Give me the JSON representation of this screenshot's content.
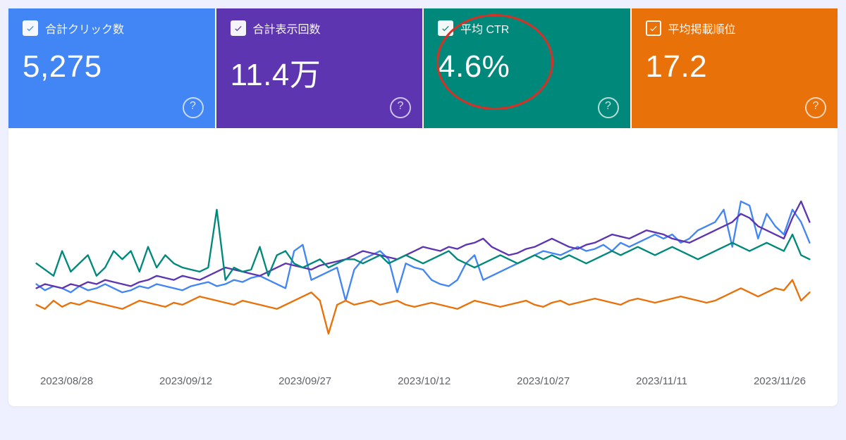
{
  "tiles": [
    {
      "key": "clicks",
      "label": "合計クリック数",
      "value": "5,275",
      "color": "#4285F4"
    },
    {
      "key": "impressions",
      "label": "合計表示回数",
      "value": "11.4万",
      "color": "#5E35B1"
    },
    {
      "key": "ctr",
      "label": "平均 CTR",
      "value": "4.6%",
      "color": "#00897B",
      "highlighted": true
    },
    {
      "key": "position",
      "label": "平均掲載順位",
      "value": "17.2",
      "color": "#E8710A"
    }
  ],
  "x_ticks": [
    "2023/08/28",
    "2023/09/12",
    "2023/09/27",
    "2023/10/12",
    "2023/10/27",
    "2023/11/11",
    "2023/11/26"
  ],
  "chart_data": {
    "type": "line",
    "title": "",
    "xlabel": "",
    "ylabel": "",
    "x_tick_labels": [
      "2023/08/28",
      "2023/09/12",
      "2023/09/27",
      "2023/10/12",
      "2023/10/27",
      "2023/11/11",
      "2023/11/26"
    ],
    "y_domain_note": "Each series is on its own scale (Google Search Console overlay). Values below are visual positions on a shared 0–100 axis where 100 is chart top and 0 is chart bottom (approximate readings from gridless figure).",
    "series": [
      {
        "name": "合計クリック数",
        "key": "clicks",
        "color": "#4285F4",
        "values": [
          38,
          35,
          37,
          36,
          34,
          37,
          35,
          36,
          38,
          36,
          34,
          35,
          37,
          36,
          38,
          37,
          36,
          35,
          37,
          38,
          39,
          37,
          38,
          40,
          39,
          41,
          42,
          40,
          38,
          36,
          54,
          57,
          40,
          42,
          44,
          46,
          30,
          45,
          50,
          52,
          54,
          50,
          34,
          48,
          46,
          45,
          40,
          38,
          37,
          40,
          48,
          52,
          40,
          42,
          44,
          46,
          48,
          50,
          52,
          54,
          53,
          52,
          54,
          56,
          54,
          55,
          57,
          54,
          58,
          56,
          58,
          60,
          62,
          60,
          62,
          58,
          60,
          64,
          66,
          68,
          74,
          56,
          78,
          76,
          60,
          72,
          66,
          62,
          74,
          68,
          58
        ]
      },
      {
        "name": "合計表示回数",
        "key": "impressions",
        "color": "#5E35B1",
        "values": [
          36,
          38,
          37,
          36,
          38,
          37,
          39,
          38,
          40,
          39,
          38,
          37,
          39,
          40,
          42,
          41,
          40,
          42,
          41,
          40,
          42,
          44,
          46,
          45,
          44,
          43,
          42,
          44,
          46,
          48,
          47,
          46,
          45,
          47,
          48,
          49,
          50,
          52,
          54,
          53,
          52,
          51,
          50,
          52,
          54,
          56,
          55,
          54,
          56,
          55,
          57,
          58,
          60,
          56,
          54,
          52,
          53,
          55,
          56,
          58,
          60,
          58,
          56,
          55,
          57,
          58,
          60,
          62,
          61,
          60,
          62,
          64,
          63,
          62,
          60,
          59,
          58,
          60,
          62,
          64,
          66,
          68,
          72,
          70,
          66,
          64,
          62,
          60,
          70,
          78,
          68
        ]
      },
      {
        "name": "平均 CTR",
        "key": "ctr",
        "color": "#00897B",
        "values": [
          48,
          45,
          42,
          54,
          44,
          48,
          52,
          42,
          46,
          54,
          50,
          54,
          44,
          56,
          46,
          52,
          48,
          46,
          45,
          44,
          46,
          74,
          40,
          46,
          44,
          45,
          56,
          42,
          52,
          54,
          48,
          46,
          48,
          50,
          46,
          48,
          50,
          50,
          48,
          50,
          52,
          48,
          50,
          52,
          50,
          48,
          50,
          52,
          54,
          50,
          48,
          46,
          48,
          50,
          52,
          50,
          48,
          50,
          52,
          50,
          52,
          50,
          52,
          50,
          48,
          50,
          52,
          54,
          52,
          54,
          56,
          54,
          52,
          54,
          56,
          54,
          52,
          50,
          52,
          54,
          56,
          58,
          56,
          54,
          56,
          58,
          56,
          54,
          62,
          52,
          50
        ]
      },
      {
        "name": "平均掲載順位",
        "key": "position",
        "color": "#E8710A",
        "values": [
          28,
          26,
          30,
          27,
          29,
          28,
          30,
          29,
          28,
          27,
          26,
          28,
          30,
          29,
          28,
          27,
          29,
          28,
          30,
          32,
          31,
          30,
          29,
          28,
          30,
          29,
          28,
          27,
          26,
          28,
          30,
          32,
          34,
          30,
          14,
          28,
          30,
          28,
          29,
          30,
          28,
          29,
          30,
          28,
          27,
          28,
          29,
          28,
          27,
          26,
          28,
          30,
          29,
          28,
          27,
          28,
          29,
          30,
          28,
          27,
          29,
          30,
          28,
          29,
          30,
          31,
          30,
          29,
          28,
          30,
          31,
          30,
          29,
          30,
          31,
          32,
          31,
          30,
          29,
          30,
          32,
          34,
          36,
          34,
          32,
          34,
          36,
          35,
          40,
          30,
          34
        ]
      }
    ]
  }
}
